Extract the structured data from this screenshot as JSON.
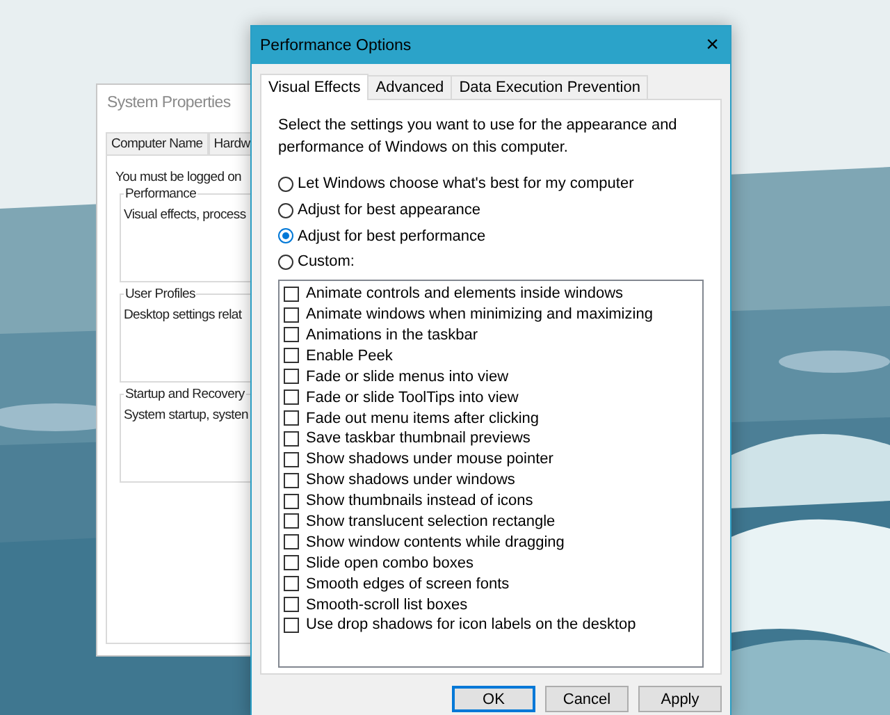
{
  "back_window": {
    "title": "System Properties",
    "tabs": [
      "Computer Name",
      "Hardw"
    ],
    "notice": "You must be logged on",
    "groups": [
      {
        "title": "Performance",
        "text": "Visual effects, process"
      },
      {
        "title": "User Profiles",
        "text": "Desktop settings relat"
      },
      {
        "title": "Startup and Recovery",
        "text": "System startup, systen"
      }
    ]
  },
  "window": {
    "title": "Performance Options",
    "close": "×"
  },
  "tabs": [
    {
      "label": "Visual Effects",
      "selected": true
    },
    {
      "label": "Advanced",
      "selected": false
    },
    {
      "label": "Data Execution Prevention",
      "selected": false
    }
  ],
  "intro": "Select the settings you want to use for the appearance and performance of Windows on this computer.",
  "options": [
    {
      "label": "Let Windows choose what's best for my computer",
      "selected": false
    },
    {
      "label": "Adjust for best appearance",
      "selected": false
    },
    {
      "label": "Adjust for best performance",
      "selected": true
    },
    {
      "label": "Custom:",
      "selected": false
    }
  ],
  "effects": [
    {
      "label": "Animate controls and elements inside windows",
      "checked": false
    },
    {
      "label": "Animate windows when minimizing and maximizing",
      "checked": false
    },
    {
      "label": "Animations in the taskbar",
      "checked": false
    },
    {
      "label": "Enable Peek",
      "checked": false
    },
    {
      "label": "Fade or slide menus into view",
      "checked": false
    },
    {
      "label": "Fade or slide ToolTips into view",
      "checked": false
    },
    {
      "label": "Fade out menu items after clicking",
      "checked": false
    },
    {
      "label": "Save taskbar thumbnail previews",
      "checked": false
    },
    {
      "label": "Show shadows under mouse pointer",
      "checked": false
    },
    {
      "label": "Show shadows under windows",
      "checked": false
    },
    {
      "label": "Show thumbnails instead of icons",
      "checked": false
    },
    {
      "label": "Show translucent selection rectangle",
      "checked": false
    },
    {
      "label": "Show window contents while dragging",
      "checked": false
    },
    {
      "label": "Slide open combo boxes",
      "checked": false
    },
    {
      "label": "Smooth edges of screen fonts",
      "checked": false
    },
    {
      "label": "Smooth-scroll list boxes",
      "checked": false
    },
    {
      "label": "Use drop shadows for icon labels on the desktop",
      "checked": false
    }
  ],
  "buttons": [
    {
      "label": "OK",
      "selected": true
    },
    {
      "label": "Cancel",
      "selected": false
    },
    {
      "label": "Apply",
      "selected": false
    }
  ]
}
